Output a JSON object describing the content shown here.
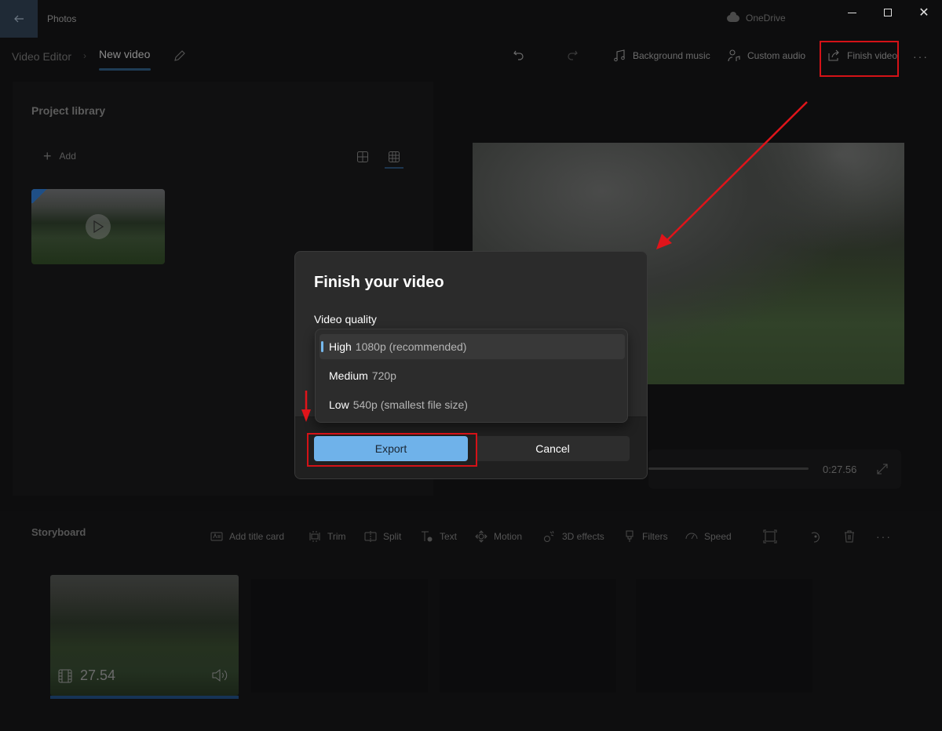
{
  "titlebar": {
    "app_title": "Photos",
    "back_icon": "back-arrow-icon",
    "onedrive_label": "OneDrive",
    "controls": {
      "minimize": "minimize-icon",
      "maximize": "maximize-icon",
      "close": "✕"
    }
  },
  "header": {
    "breadcrumb_root": "Video Editor",
    "breadcrumb_separator": "›",
    "breadcrumb_current": "New video",
    "toolbar": {
      "undo_icon": "undo-icon",
      "redo_icon": "redo-icon",
      "background_music": "Background music",
      "custom_audio": "Custom audio",
      "finish_video": "Finish video",
      "more": "···"
    }
  },
  "library": {
    "title": "Project library",
    "add_label": "Add",
    "add_icon": "+"
  },
  "preview": {
    "time": "0:27.56"
  },
  "storyboard": {
    "title": "Storyboard",
    "tools": {
      "add_title_card": "Add title card",
      "trim": "Trim",
      "split": "Split",
      "text": "Text",
      "motion": "Motion",
      "effects_3d": "3D effects",
      "filters": "Filters",
      "speed": "Speed",
      "more": "···"
    },
    "clip": {
      "duration": "27.54"
    }
  },
  "dialog": {
    "title": "Finish your video",
    "quality_label": "Video quality",
    "options": [
      {
        "name": "High",
        "desc": "1080p (recommended)",
        "selected": true
      },
      {
        "name": "Medium",
        "desc": "720p",
        "selected": false
      },
      {
        "name": "Low",
        "desc": "540p (smallest file size)",
        "selected": false
      }
    ],
    "export_label": "Export",
    "cancel_label": "Cancel"
  },
  "colors": {
    "accent": "#76b9ed",
    "export_button": "#6fb2ea",
    "annotation_red": "#d41217"
  }
}
